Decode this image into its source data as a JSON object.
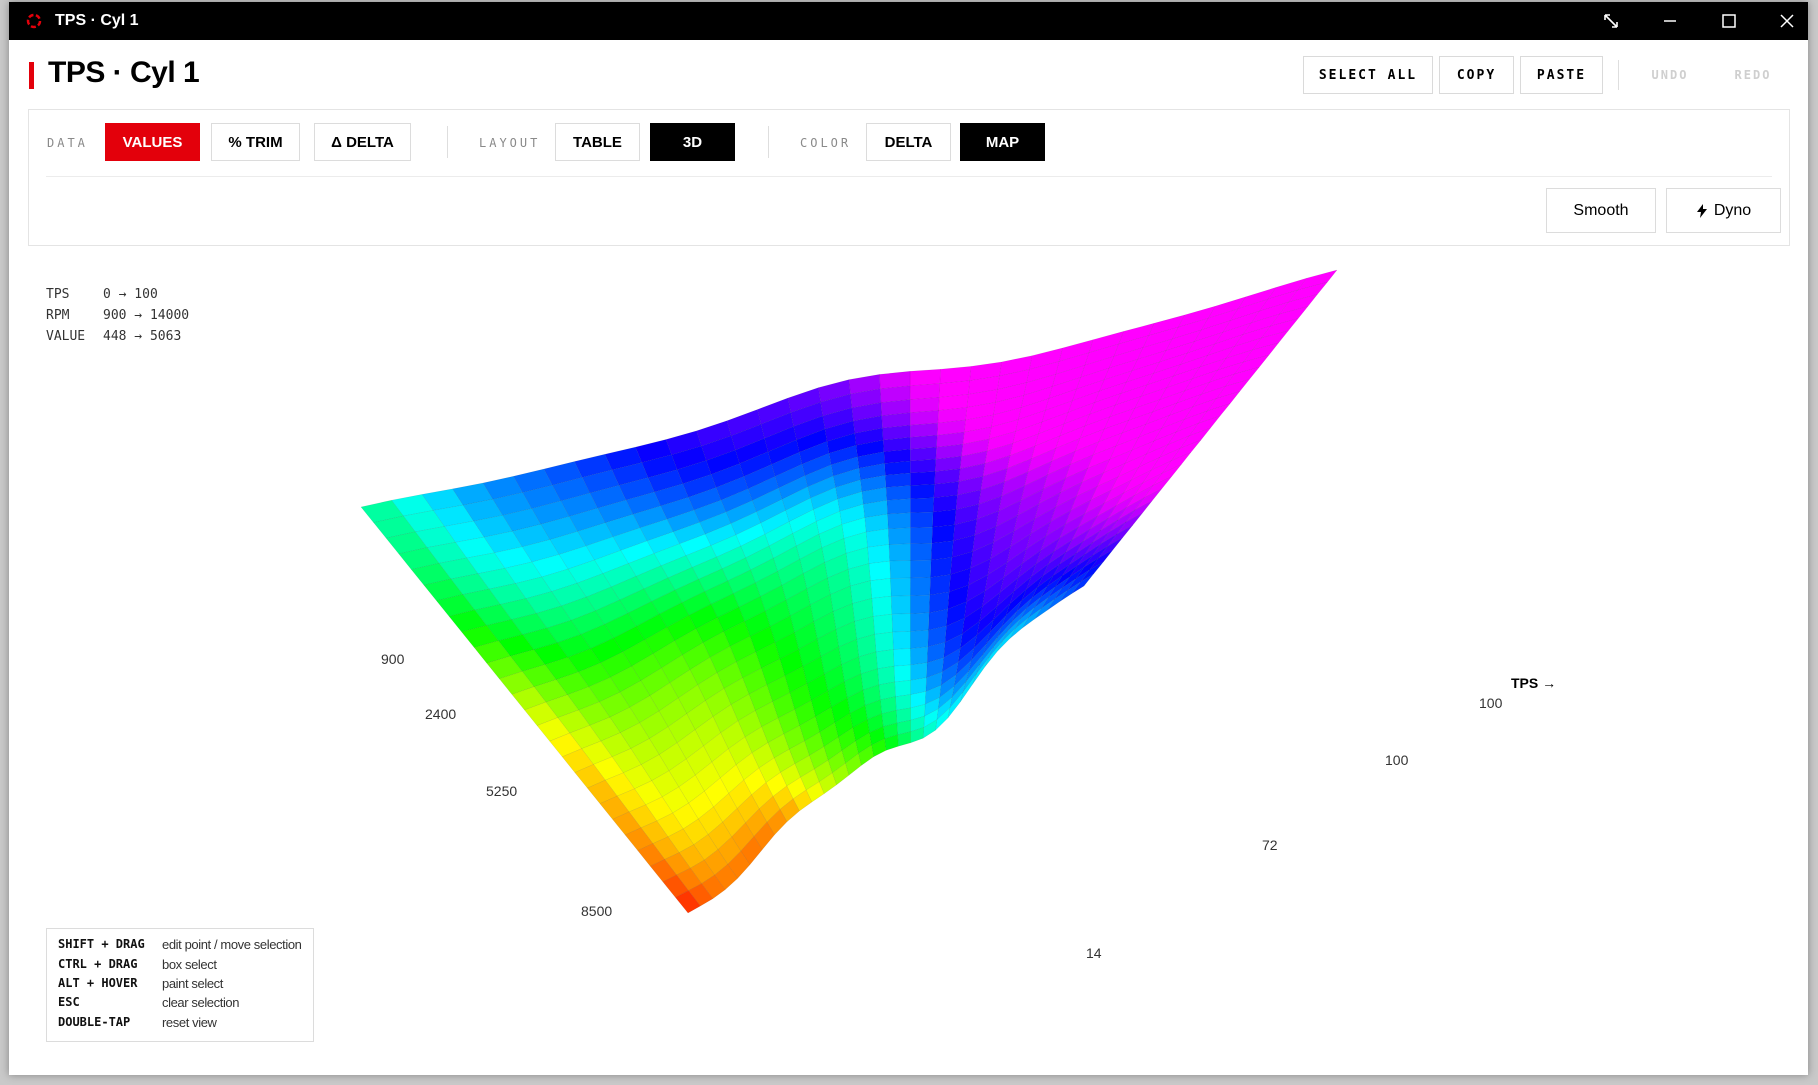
{
  "window": {
    "title": "TPS · Cyl 1",
    "controls": {
      "expand": "expand-icon",
      "minimize": "minimize-icon",
      "maximize": "maximize-icon",
      "close": "close-icon"
    }
  },
  "header": {
    "title": "TPS · Cyl 1",
    "accent_color": "#e3000b",
    "actions": {
      "select_all": "SELECT ALL",
      "copy": "COPY",
      "paste": "PASTE",
      "undo": "UNDO",
      "redo": "REDO"
    }
  },
  "toolbar": {
    "data_label": "DATA",
    "data_options": [
      "VALUES",
      "% TRIM",
      "Δ DELTA"
    ],
    "data_selected": "VALUES",
    "layout_label": "LAYOUT",
    "layout_options": [
      "TABLE",
      "3D"
    ],
    "layout_selected": "3D",
    "color_label": "COLOR",
    "color_options": [
      "DELTA",
      "MAP"
    ],
    "color_selected": "MAP",
    "smooth_label": "Smooth",
    "dyno_label": "Dyno",
    "dyno_icon": "lightning-icon"
  },
  "ranges": [
    {
      "key": "TPS",
      "value": "0 → 100"
    },
    {
      "key": "RPM",
      "value": "900 → 14000"
    },
    {
      "key": "VALUE",
      "value": "448 → 5063"
    }
  ],
  "surface": {
    "rpm_axis_labels": [
      "900",
      "2400",
      "5250",
      "8500"
    ],
    "tps_axis_title": "TPS →",
    "tps_axis_labels": [
      "100",
      "100",
      "72",
      "14"
    ],
    "colormap": "rainbow (red = low value, magenta = high value)"
  },
  "shortcuts": [
    {
      "key": "SHIFT + DRAG",
      "desc": "edit point / move selection"
    },
    {
      "key": "CTRL + DRAG",
      "desc": "box select"
    },
    {
      "key": "ALT + HOVER",
      "desc": "paint select"
    },
    {
      "key": "ESC",
      "desc": "clear selection"
    },
    {
      "key": "DOUBLE-TAP",
      "desc": "reset view"
    }
  ]
}
